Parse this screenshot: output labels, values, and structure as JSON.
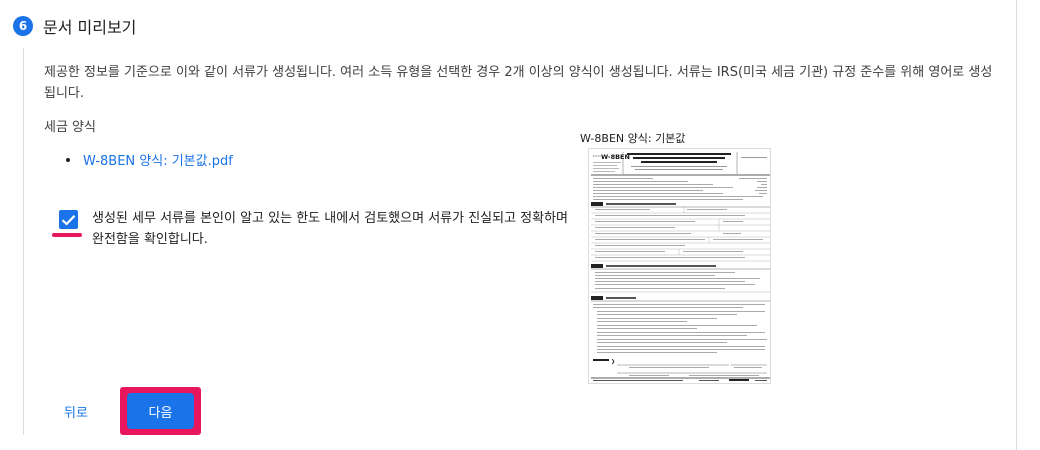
{
  "step": {
    "number": "6",
    "title": "문서 미리보기"
  },
  "description": "제공한 정보를 기준으로 이와 같이 서류가 생성됩니다. 여러 소득 유형을 선택한 경우 2개 이상의 양식이 생성됩니다. 서류는 IRS(미국 세금 기관) 규정 준수를 위해 영어로 생성됩니다.",
  "tax_forms": {
    "label": "세금 양식",
    "files": [
      "W-8BEN 양식: 기본값.pdf"
    ]
  },
  "confirmation": {
    "checked": true,
    "text": "생성된 세무 서류를 본인이 알고 있는 한도 내에서 검토했으며 서류가 진실되고 정확하며 완전함을 확인합니다."
  },
  "preview": {
    "label": "W-8BEN 양식: 기본값",
    "form_id": "W-8BEN",
    "form_heading": "Certificate of Foreign Status of Beneficial Owner for United States Tax Withholding and Reporting (Individuals)",
    "parts": [
      "Part I",
      "Part II",
      "Part III"
    ],
    "sign_label": "Sign Here"
  },
  "buttons": {
    "back": "뒤로",
    "next": "다음"
  },
  "colors": {
    "accent": "#1a73e8",
    "highlight": "#e8175d"
  }
}
